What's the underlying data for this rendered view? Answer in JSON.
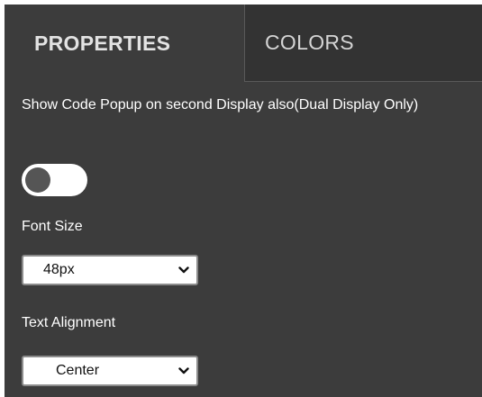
{
  "tabs": [
    {
      "label": "PROPERTIES",
      "active": true
    },
    {
      "label": "COLORS",
      "active": false
    }
  ],
  "properties": {
    "dual_display_label": "Show Code Popup on second Display also(Dual Display Only)",
    "dual_display_toggle": {
      "on": false
    },
    "font_size_label": "Font Size",
    "font_size_value": "48px",
    "text_alignment_label": "Text Alignment",
    "text_alignment_value": "Center"
  },
  "colors": {
    "panel_bg": "#3c3c3c",
    "inactive_tab_bg": "#333333",
    "text": "#ffffff"
  }
}
